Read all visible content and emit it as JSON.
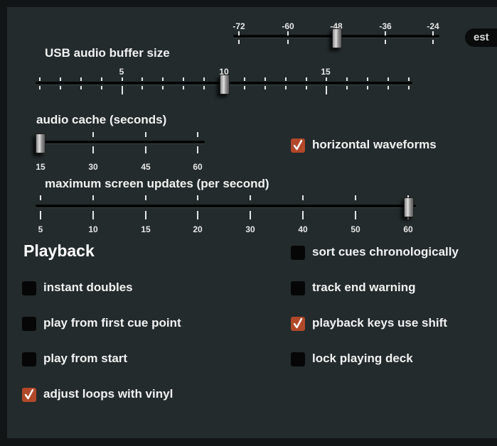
{
  "top_slider": {
    "tick_labels": [
      "-72",
      "-60",
      "-48",
      "-36",
      "-24"
    ],
    "value": "-48"
  },
  "pill": {
    "label": "est"
  },
  "usb_buffer": {
    "label": "USB audio buffer size",
    "tick_labels": [
      "5",
      "10",
      "15"
    ],
    "value": "10"
  },
  "audio_cache": {
    "label": "audio cache (seconds)",
    "tick_labels": [
      "15",
      "30",
      "45",
      "60"
    ],
    "value": "15"
  },
  "screen_updates": {
    "label": "maximum screen updates (per second)",
    "tick_labels": [
      "5",
      "10",
      "15",
      "20",
      "30",
      "40",
      "50",
      "60"
    ],
    "value": "60"
  },
  "horizontal_waveforms": {
    "label": "horizontal waveforms",
    "checked": true
  },
  "playback": {
    "title": "Playback",
    "left_options": [
      {
        "label": "instant doubles",
        "checked": false
      },
      {
        "label": "play from first cue point",
        "checked": false
      },
      {
        "label": "play from start",
        "checked": false
      },
      {
        "label": "adjust loops with vinyl",
        "checked": true
      }
    ],
    "right_options": [
      {
        "label": "sort cues chronologically",
        "checked": false
      },
      {
        "label": "track end warning",
        "checked": false
      },
      {
        "label": "playback keys use shift",
        "checked": true
      },
      {
        "label": "lock playing deck",
        "checked": false
      }
    ]
  },
  "colors": {
    "panel": "#232b2c",
    "check": "#b2482a",
    "track": "#050505"
  }
}
